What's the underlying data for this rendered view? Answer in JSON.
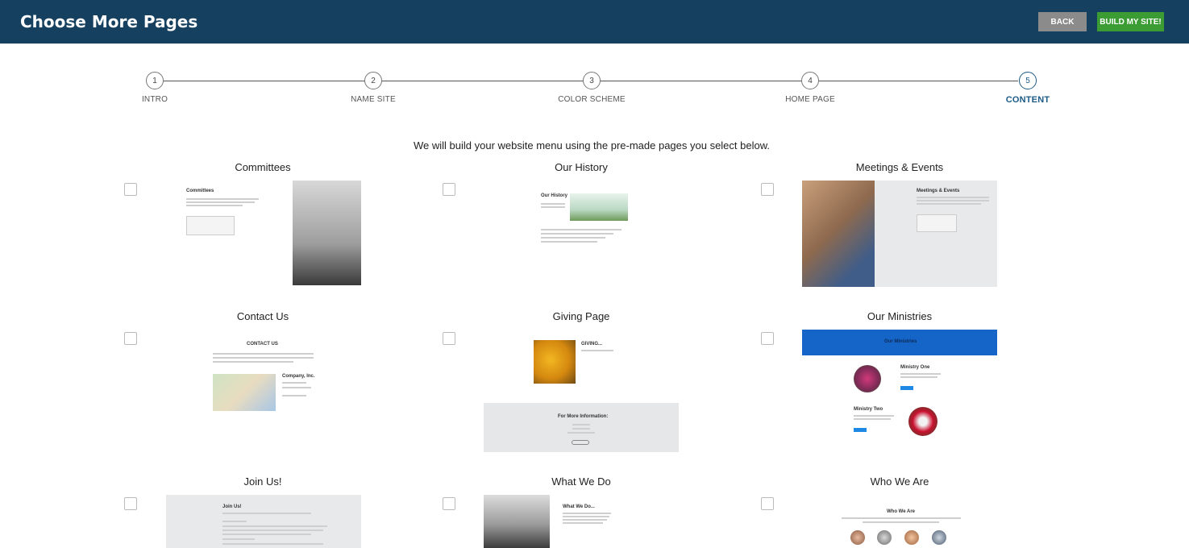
{
  "header": {
    "title": "Choose More Pages",
    "back_label": "BACK",
    "build_label": "BUILD MY SITE!"
  },
  "steps": [
    {
      "number": "1",
      "label": "INTRO"
    },
    {
      "number": "2",
      "label": "NAME SITE"
    },
    {
      "number": "3",
      "label": "COLOR SCHEME"
    },
    {
      "number": "4",
      "label": "HOME PAGE"
    },
    {
      "number": "5",
      "label": "CONTENT",
      "active": true
    }
  ],
  "instruction": "We will build your website menu using the pre-made pages you select below.",
  "pages": [
    {
      "title": "Committees",
      "thumb_heading": "Committees",
      "checked": false
    },
    {
      "title": "Our History",
      "thumb_heading": "Our History",
      "checked": false
    },
    {
      "title": "Meetings & Events",
      "thumb_heading": "Meetings & Events",
      "checked": false
    },
    {
      "title": "Contact Us",
      "thumb_heading": "CONTACT US",
      "thumb_sub": "Company, Inc.",
      "checked": false
    },
    {
      "title": "Giving Page",
      "thumb_heading": "GIVING...",
      "thumb_sub": "For More Information:",
      "checked": false
    },
    {
      "title": "Our Ministries",
      "thumb_heading": "Our Ministries",
      "thumb_sub": "Ministry One",
      "thumb_sub2": "Ministry Two",
      "checked": false
    },
    {
      "title": "Join Us!",
      "thumb_heading": "Join Us!",
      "checked": false
    },
    {
      "title": "What We Do",
      "thumb_heading": "What We Do...",
      "checked": false
    },
    {
      "title": "Who We Are",
      "thumb_heading": "Who We Are",
      "checked": false
    }
  ],
  "colors": {
    "header_bg": "#16405f",
    "accent": "#1d5b87",
    "build_button": "#3a9c33",
    "back_button": "#8b8b8b"
  }
}
